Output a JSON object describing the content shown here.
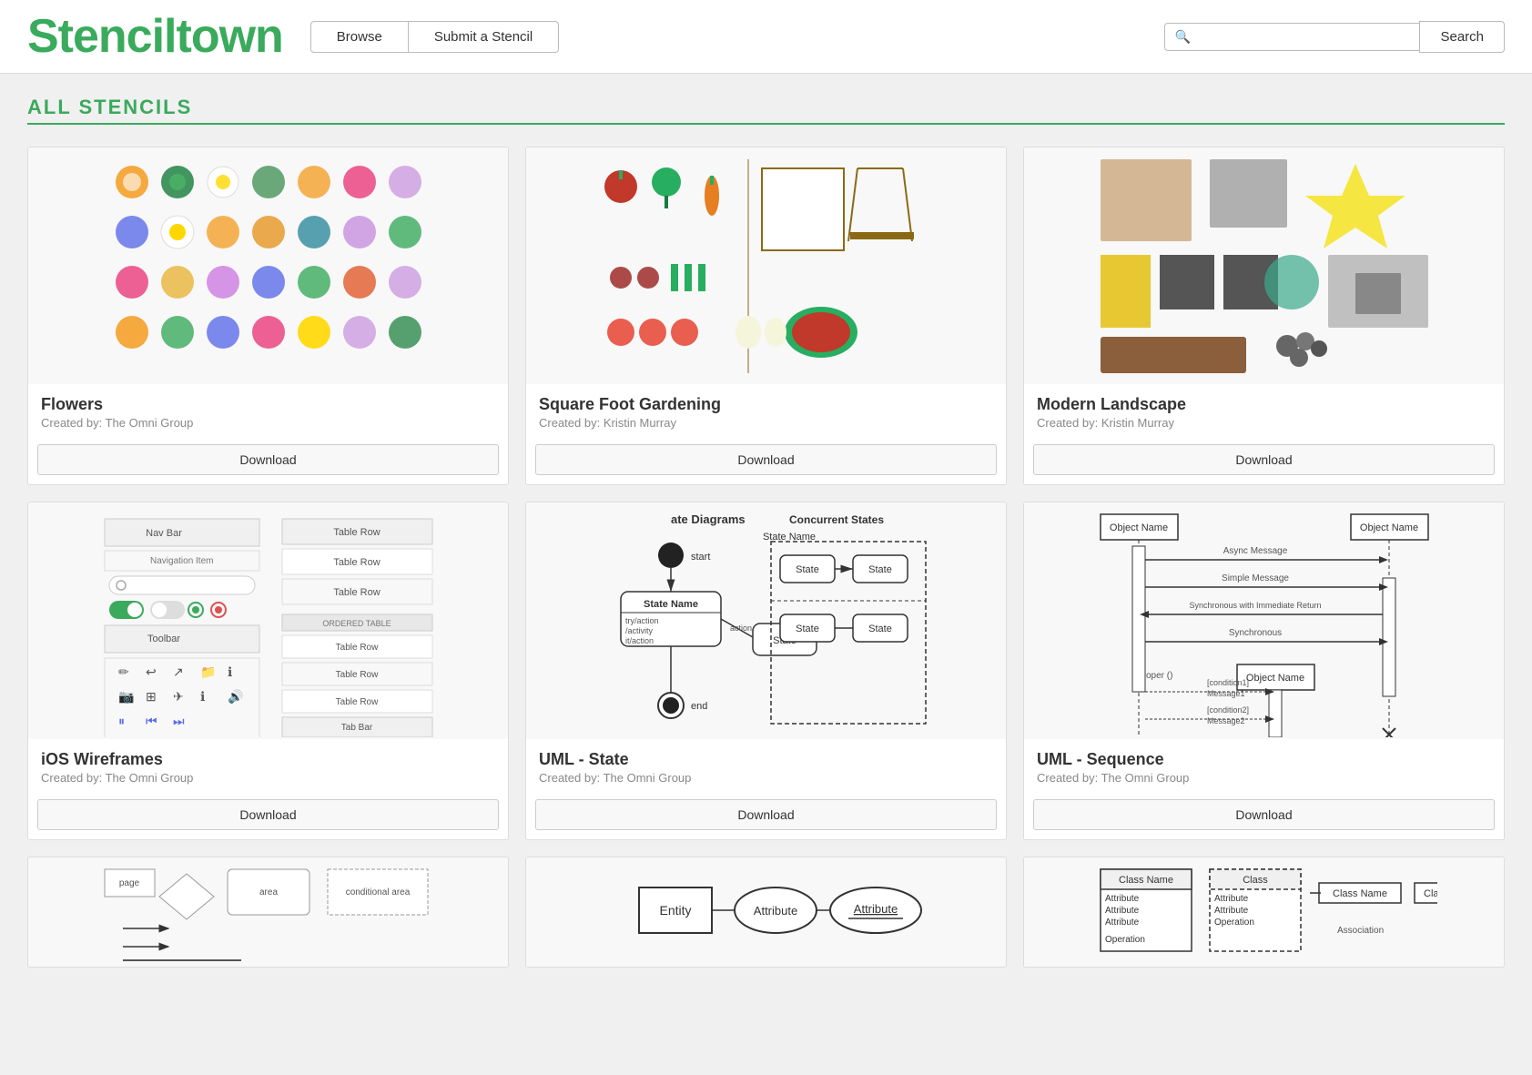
{
  "header": {
    "logo": "Stenciltown",
    "nav": {
      "browse_label": "Browse",
      "submit_label": "Submit a Stencil",
      "search_label": "Search",
      "search_placeholder": ""
    }
  },
  "section": {
    "title": "ALL STENCILS"
  },
  "cards": [
    {
      "id": "flowers",
      "title": "Flowers",
      "author": "Created by: The Omni Group",
      "download_label": "Download",
      "type": "flowers"
    },
    {
      "id": "garden",
      "title": "Square Foot Gardening",
      "author": "Created by: Kristin Murray",
      "download_label": "Download",
      "type": "garden"
    },
    {
      "id": "landscape",
      "title": "Modern Landscape",
      "author": "Created by: Kristin Murray",
      "download_label": "Download",
      "type": "landscape"
    },
    {
      "id": "ios",
      "title": "iOS Wireframes",
      "author": "Created by: The Omni Group",
      "download_label": "Download",
      "type": "ios"
    },
    {
      "id": "uml-state",
      "title": "UML - State",
      "author": "Created by: The Omni Group",
      "download_label": "Download",
      "type": "uml-state"
    },
    {
      "id": "uml-sequence",
      "title": "UML - Sequence",
      "author": "Created by: The Omni Group",
      "download_label": "Download",
      "type": "uml-sequence"
    }
  ],
  "bottom_cards": [
    {
      "id": "flowchart",
      "type": "flowchart"
    },
    {
      "id": "er-diagram",
      "type": "er-diagram"
    },
    {
      "id": "class-diagram",
      "type": "class-diagram"
    }
  ],
  "icons": {
    "search": "🔍"
  }
}
